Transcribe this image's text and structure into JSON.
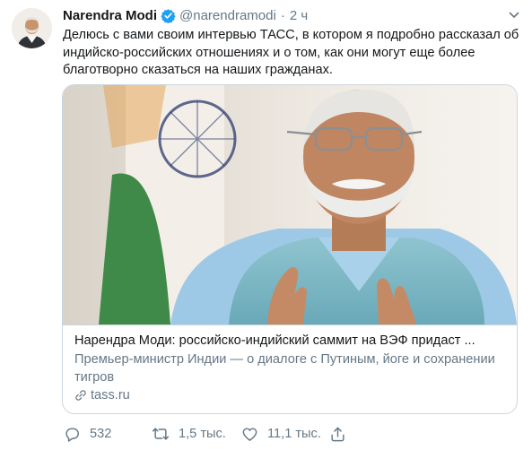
{
  "tweet": {
    "author_name": "Narendra Modi",
    "handle": "@narendramodi",
    "separator": "·",
    "time": "2 ч",
    "text": "Делюсь с вами своим интервью ТАСС, в котором я подробно рассказал об индийско-российских отношениях и о том, как они могут еще более благотворно сказаться на наших гражданах."
  },
  "card": {
    "title": "Нарендра Моди: российско-индийский саммит на ВЭФ придаст ...",
    "description": "Премьер-министр Индии — о диалоге с Путиным, йоге и сохранении тигров",
    "domain": "tass.ru"
  },
  "actions": {
    "reply_count": "532",
    "retweet_count": "1,5 тыс.",
    "like_count": "11,1 тыс."
  },
  "icons": {
    "verified": "verified-badge-icon",
    "menu": "chevron-down-icon",
    "link": "link-icon",
    "reply": "reply-icon",
    "retweet": "retweet-icon",
    "like": "like-icon",
    "share": "share-icon"
  },
  "colors": {
    "accent": "#1da1f2",
    "text": "#14171a",
    "secondary": "#657786",
    "border": "#ccd6dd"
  }
}
